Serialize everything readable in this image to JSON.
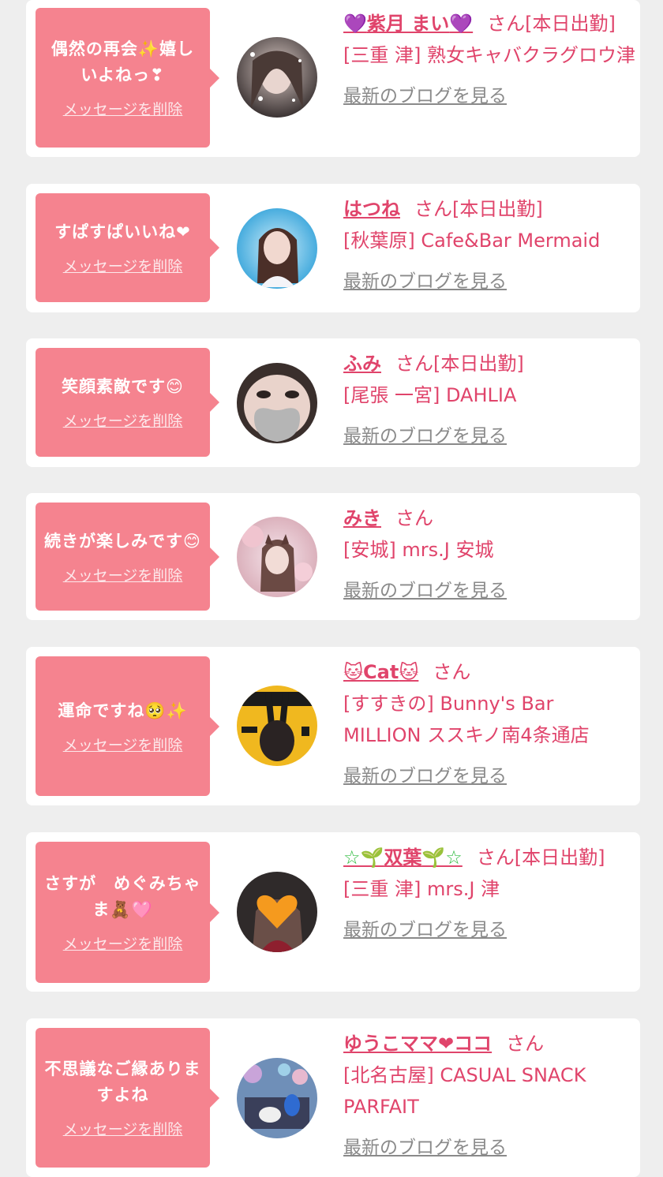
{
  "items": [
    {
      "message": "偶然の再会✨嬉しいよねっ❣",
      "delete_label": "メッセージを削除",
      "name_prefix": "💜",
      "name": "紫月 まい",
      "name_suffix": "💜",
      "san_label": "さん[本日出勤]",
      "shop": "[三重 津] 熟女キャバクラグロウ津",
      "blog_label": "最新のブログを見る"
    },
    {
      "message": "すぱすぱいいね❤",
      "delete_label": "メッセージを削除",
      "name_prefix": "",
      "name": "はつね",
      "name_suffix": "",
      "san_label": "さん[本日出勤]",
      "shop": "[秋葉原] Cafe&Bar Mermaid",
      "blog_label": "最新のブログを見る"
    },
    {
      "message": "笑顔素敵です😊",
      "delete_label": "メッセージを削除",
      "name_prefix": "",
      "name": "ふみ",
      "name_suffix": "",
      "san_label": "さん[本日出勤]",
      "shop": "[尾張 一宮] DAHLIA",
      "blog_label": "最新のブログを見る"
    },
    {
      "message": "続きが楽しみです😊",
      "delete_label": "メッセージを削除",
      "name_prefix": "",
      "name": "みき",
      "name_suffix": "",
      "san_label": "さん",
      "shop": "[安城] mrs.J 安城",
      "blog_label": "最新のブログを見る"
    },
    {
      "message": "運命ですね🥺✨",
      "delete_label": "メッセージを削除",
      "name_prefix": "🐱",
      "name": "Cat",
      "name_suffix": "🐱",
      "san_label": "さん",
      "shop": "[すすきの] Bunny's Bar MILLION ススキノ南4条通店",
      "blog_label": "最新のブログを見る"
    },
    {
      "message": "さすが　めぐみちゃま🧸🩷",
      "delete_label": "メッセージを削除",
      "name_prefix": "☆🌱",
      "name": "双葉",
      "name_suffix": "🌱☆",
      "san_label": "さん[本日出勤]",
      "shop": "[三重 津] mrs.J 津",
      "blog_label": "最新のブログを見る"
    },
    {
      "message": "不思議なご縁ありますよね",
      "delete_label": "メッセージを削除",
      "name_prefix": "",
      "name": "ゆうこママ❤ココ",
      "name_suffix": "",
      "san_label": "さん",
      "shop": "[北名古屋] CASUAL SNACK PARFAIT",
      "blog_label": "最新のブログを見る"
    }
  ],
  "colors": {
    "bubble": "#f5838f",
    "accent": "#e0446b",
    "link_gray": "#8a8a8a",
    "background": "#eeeeee"
  }
}
